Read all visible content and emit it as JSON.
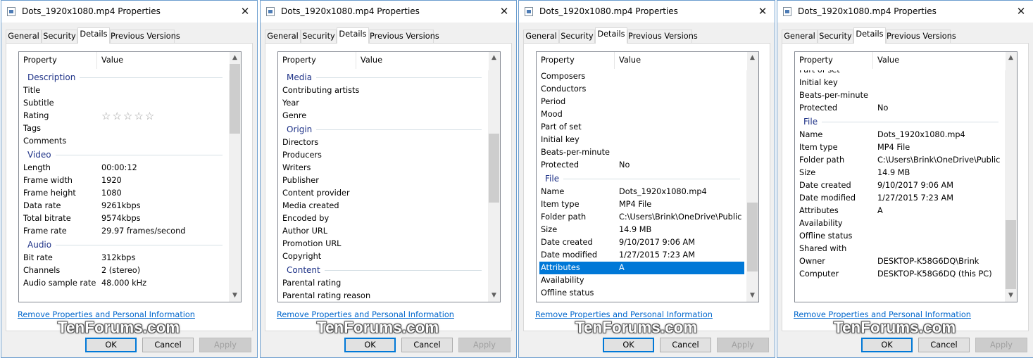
{
  "windows": [
    {
      "title": "Dots_1920x1080.mp4 Properties",
      "tabs": [
        {
          "label": "General"
        },
        {
          "label": "Security"
        },
        {
          "label": "Details"
        },
        {
          "label": "Previous Versions"
        }
      ],
      "active_tab": "Details",
      "columns": {
        "property": "Property",
        "value": "Value"
      },
      "scroll_offset_rows": 0,
      "items": [
        {
          "kind": "group",
          "name": "Description"
        },
        {
          "kind": "row",
          "property": "Title",
          "value": ""
        },
        {
          "kind": "row",
          "property": "Subtitle",
          "value": ""
        },
        {
          "kind": "row",
          "property": "Rating",
          "value": "☆☆☆☆☆",
          "rating_stars": 0
        },
        {
          "kind": "row",
          "property": "Tags",
          "value": ""
        },
        {
          "kind": "row",
          "property": "Comments",
          "value": ""
        },
        {
          "kind": "group",
          "name": "Video"
        },
        {
          "kind": "row",
          "property": "Length",
          "value": "00:00:12"
        },
        {
          "kind": "row",
          "property": "Frame width",
          "value": "1920"
        },
        {
          "kind": "row",
          "property": "Frame height",
          "value": "1080"
        },
        {
          "kind": "row",
          "property": "Data rate",
          "value": "9261kbps"
        },
        {
          "kind": "row",
          "property": "Total bitrate",
          "value": "9574kbps"
        },
        {
          "kind": "row",
          "property": "Frame rate",
          "value": "29.97 frames/second"
        },
        {
          "kind": "group",
          "name": "Audio"
        },
        {
          "kind": "row",
          "property": "Bit rate",
          "value": "312kbps"
        },
        {
          "kind": "row",
          "property": "Channels",
          "value": "2 (stereo)"
        },
        {
          "kind": "row",
          "property": "Audio sample rate",
          "value": "48.000 kHz"
        }
      ],
      "link_label": "Remove Properties and Personal Information",
      "buttons": {
        "ok": "OK",
        "cancel": "Cancel",
        "apply": "Apply"
      },
      "watermark": "TenForums.com"
    },
    {
      "title": "Dots_1920x1080.mp4 Properties",
      "tabs": [
        {
          "label": "General"
        },
        {
          "label": "Security"
        },
        {
          "label": "Details"
        },
        {
          "label": "Previous Versions"
        }
      ],
      "active_tab": "Details",
      "columns": {
        "property": "Property",
        "value": "Value"
      },
      "scroll_offset_rows": 0,
      "items": [
        {
          "kind": "group",
          "name": "Media"
        },
        {
          "kind": "row",
          "property": "Contributing artists",
          "value": ""
        },
        {
          "kind": "row",
          "property": "Year",
          "value": ""
        },
        {
          "kind": "row",
          "property": "Genre",
          "value": ""
        },
        {
          "kind": "group",
          "name": "Origin"
        },
        {
          "kind": "row",
          "property": "Directors",
          "value": ""
        },
        {
          "kind": "row",
          "property": "Producers",
          "value": ""
        },
        {
          "kind": "row",
          "property": "Writers",
          "value": ""
        },
        {
          "kind": "row",
          "property": "Publisher",
          "value": ""
        },
        {
          "kind": "row",
          "property": "Content provider",
          "value": ""
        },
        {
          "kind": "row",
          "property": "Media created",
          "value": ""
        },
        {
          "kind": "row",
          "property": "Encoded by",
          "value": ""
        },
        {
          "kind": "row",
          "property": "Author URL",
          "value": ""
        },
        {
          "kind": "row",
          "property": "Promotion URL",
          "value": ""
        },
        {
          "kind": "row",
          "property": "Copyright",
          "value": ""
        },
        {
          "kind": "group",
          "name": "Content"
        },
        {
          "kind": "row",
          "property": "Parental rating",
          "value": ""
        },
        {
          "kind": "row",
          "property": "Parental rating reason",
          "value": ""
        }
      ],
      "link_label": "Remove Properties and Personal Information",
      "buttons": {
        "ok": "OK",
        "cancel": "Cancel",
        "apply": "Apply"
      },
      "watermark": "TenForums.com"
    },
    {
      "title": "Dots_1920x1080.mp4 Properties",
      "tabs": [
        {
          "label": "General"
        },
        {
          "label": "Security"
        },
        {
          "label": "Details"
        },
        {
          "label": "Previous Versions"
        }
      ],
      "active_tab": "Details",
      "columns": {
        "property": "Property",
        "value": "Value"
      },
      "scroll_offset_rows": 0,
      "items": [
        {
          "kind": "row",
          "property": "Composers",
          "value": ""
        },
        {
          "kind": "row",
          "property": "Conductors",
          "value": ""
        },
        {
          "kind": "row",
          "property": "Period",
          "value": ""
        },
        {
          "kind": "row",
          "property": "Mood",
          "value": ""
        },
        {
          "kind": "row",
          "property": "Part of set",
          "value": ""
        },
        {
          "kind": "row",
          "property": "Initial key",
          "value": ""
        },
        {
          "kind": "row",
          "property": "Beats-per-minute",
          "value": ""
        },
        {
          "kind": "row",
          "property": "Protected",
          "value": "No"
        },
        {
          "kind": "group",
          "name": "File"
        },
        {
          "kind": "row",
          "property": "Name",
          "value": "Dots_1920x1080.mp4"
        },
        {
          "kind": "row",
          "property": "Item type",
          "value": "MP4 File"
        },
        {
          "kind": "row",
          "property": "Folder path",
          "value": "C:\\Users\\Brink\\OneDrive\\Public"
        },
        {
          "kind": "row",
          "property": "Size",
          "value": "14.9 MB"
        },
        {
          "kind": "row",
          "property": "Date created",
          "value": "9/10/2017 9:06 AM"
        },
        {
          "kind": "row",
          "property": "Date modified",
          "value": "1/27/2015 7:23 AM"
        },
        {
          "kind": "row",
          "property": "Attributes",
          "value": "A",
          "selected": true
        },
        {
          "kind": "row",
          "property": "Availability",
          "value": ""
        },
        {
          "kind": "row",
          "property": "Offline status",
          "value": ""
        }
      ],
      "link_label": "Remove Properties and Personal Information",
      "buttons": {
        "ok": "OK",
        "cancel": "Cancel",
        "apply": "Apply"
      },
      "watermark": "TenForums.com"
    },
    {
      "title": "Dots_1920x1080.mp4 Properties",
      "tabs": [
        {
          "label": "General"
        },
        {
          "label": "Security"
        },
        {
          "label": "Details"
        },
        {
          "label": "Previous Versions"
        }
      ],
      "active_tab": "Details",
      "columns": {
        "property": "Property",
        "value": "Value"
      },
      "scroll_offset_rows": 0.5,
      "items": [
        {
          "kind": "row",
          "property": "Part of set",
          "value": ""
        },
        {
          "kind": "row",
          "property": "Initial key",
          "value": ""
        },
        {
          "kind": "row",
          "property": "Beats-per-minute",
          "value": ""
        },
        {
          "kind": "row",
          "property": "Protected",
          "value": "No"
        },
        {
          "kind": "group",
          "name": "File"
        },
        {
          "kind": "row",
          "property": "Name",
          "value": "Dots_1920x1080.mp4"
        },
        {
          "kind": "row",
          "property": "Item type",
          "value": "MP4 File"
        },
        {
          "kind": "row",
          "property": "Folder path",
          "value": "C:\\Users\\Brink\\OneDrive\\Public"
        },
        {
          "kind": "row",
          "property": "Size",
          "value": "14.9 MB"
        },
        {
          "kind": "row",
          "property": "Date created",
          "value": "9/10/2017 9:06 AM"
        },
        {
          "kind": "row",
          "property": "Date modified",
          "value": "1/27/2015 7:23 AM"
        },
        {
          "kind": "row",
          "property": "Attributes",
          "value": "A"
        },
        {
          "kind": "row",
          "property": "Availability",
          "value": ""
        },
        {
          "kind": "row",
          "property": "Offline status",
          "value": ""
        },
        {
          "kind": "row",
          "property": "Shared with",
          "value": ""
        },
        {
          "kind": "row",
          "property": "Owner",
          "value": "DESKTOP-K58G6DQ\\Brink"
        },
        {
          "kind": "row",
          "property": "Computer",
          "value": "DESKTOP-K58G6DQ (this PC)"
        }
      ],
      "link_label": "Remove Properties and Personal Information",
      "buttons": {
        "ok": "OK",
        "cancel": "Cancel",
        "apply": "Apply"
      },
      "watermark": "TenForums.com"
    }
  ]
}
